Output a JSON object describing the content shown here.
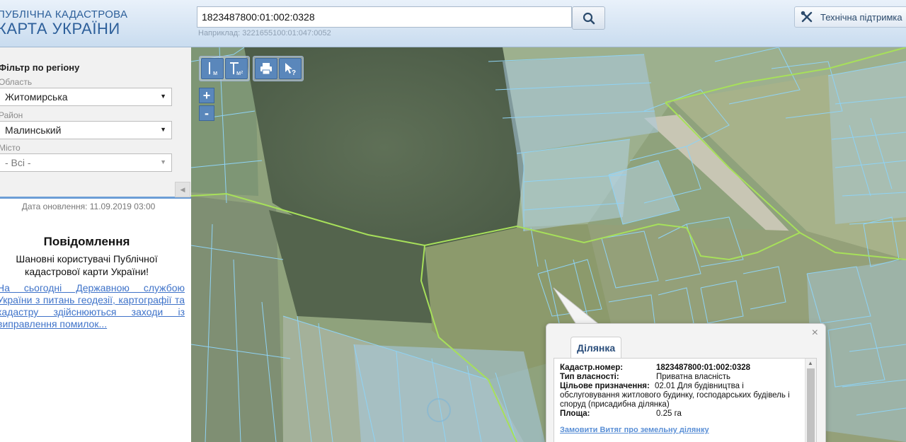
{
  "header": {
    "logo_line1": "ПУБЛІЧНА КАДАСТРОВА",
    "logo_line2": "КАРТА УКРАЇНИ",
    "search_value": "1823487800:01:002:0328",
    "search_hint": "Наприклад: 3221655100:01:047:0052",
    "support_label": "Технічна підтримка",
    "icons": [
      "search-icon",
      "tools-icon"
    ]
  },
  "sidebar": {
    "filter_title": "Фільтр по регіону",
    "region_label": "Область",
    "region_value": "Житомирська",
    "district_label": "Район",
    "district_value": "Малинський",
    "city_label": "Місто",
    "city_value": "- Всі -",
    "update_date": "Дата оновлення: 11.09.2019 03:00",
    "notice_title": "Повідомлення",
    "notice_text": "Шановні користувачі Публічної кадастрової карти України!",
    "notice_link": "На сьогодні Державною службою України з питань геодезії, картографії та кадастру здійснюються заходи із виправлення помилок..."
  },
  "map": {
    "tools": [
      "ruler-icon",
      "area-ruler-icon",
      "print-icon",
      "info-cursor-icon"
    ],
    "tool_labels": {
      "measure_length": "м",
      "measure_area": "м²"
    },
    "zoom_in": "+",
    "zoom_out": "-"
  },
  "popup": {
    "tab_label": "Ділянка",
    "cadastral_label": "Кадастр.номер:",
    "cadastral_value": "1823487800:01:002:0328",
    "ownership_label": "Тип власності:",
    "ownership_value": "Приватна власність",
    "purpose_label": "Цільове призначення:",
    "purpose_value": "02.01 Для будівництва і обслуговування житлового будинку, господарських будівель і споруд (присадибна ділянка)",
    "area_label": "Площа:",
    "area_value": "0.25 га",
    "order_link": "Замовити Витяг про земельну ділянку",
    "close": "×"
  },
  "colors": {
    "header_text": "#2d5f9a",
    "parcel_stroke": "#8fd3f5",
    "boundary": "#a7e05a",
    "link": "#3f73c9"
  }
}
